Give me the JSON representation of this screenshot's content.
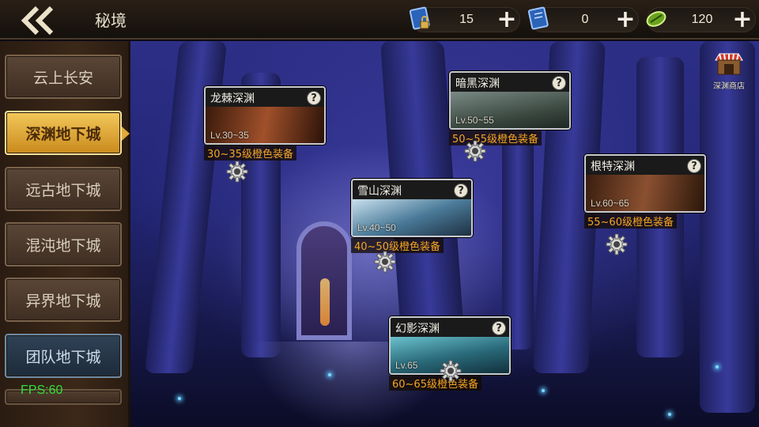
{
  "header": {
    "back_icon": "double-chevron-left-icon",
    "title": "秘境"
  },
  "resources": [
    {
      "icon": "locked-book-icon",
      "value": "15",
      "plus": "+"
    },
    {
      "icon": "book-icon",
      "value": "0",
      "plus": "+"
    },
    {
      "icon": "green-gem-icon",
      "value": "120",
      "plus": "+"
    }
  ],
  "sidebar": {
    "items": [
      {
        "label": "云上长安",
        "state": "normal"
      },
      {
        "label": "深渊地下城",
        "state": "active"
      },
      {
        "label": "远古地下城",
        "state": "normal"
      },
      {
        "label": "混沌地下城",
        "state": "normal"
      },
      {
        "label": "异界地下城",
        "state": "normal"
      },
      {
        "label": "团队地下城",
        "state": "team"
      }
    ]
  },
  "fps": "FPS:60",
  "shop": {
    "label": "深渊商店",
    "icon": "shop-stall-icon"
  },
  "dungeons": [
    {
      "name": "龙棘深渊",
      "level": "Lv.30~35",
      "reward": "30~35级橙色装备",
      "help": "?",
      "art": "#7a3a18"
    },
    {
      "name": "暗黑深渊",
      "level": "Lv.50~55",
      "reward": "50~55级橙色装备",
      "help": "?",
      "art": "#4a5a52"
    },
    {
      "name": "根特深渊",
      "level": "Lv.60~65",
      "reward": "55~60级橙色装备",
      "help": "?",
      "art": "#6a3a22"
    },
    {
      "name": "雪山深渊",
      "level": "Lv.40~50",
      "reward": "40~50级橙色装备",
      "help": "?",
      "art": "#5a8aa8"
    },
    {
      "name": "幻影深渊",
      "level": "Lv.65",
      "reward": "60~65级橙色装备",
      "help": "?",
      "art": "#2f7a8a"
    }
  ],
  "colors": {
    "reward": "#f5a623",
    "active_tab": "#e2a93a",
    "fps": "#31e03a"
  }
}
